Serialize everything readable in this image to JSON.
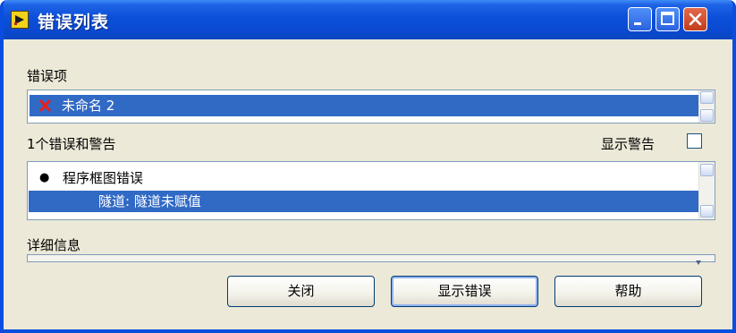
{
  "window": {
    "title": "错误列表"
  },
  "error_items": {
    "label": "错误项",
    "items": [
      {
        "icon": "red-x-icon",
        "text": "未命名 2",
        "selected": true
      }
    ]
  },
  "warnings": {
    "count_label": "1个错误和警告",
    "show_warnings_label": "显示警告",
    "show_warnings_checked": false,
    "items": [
      {
        "bullet": "●",
        "text": "程序框图错误",
        "selected": false
      },
      {
        "bullet": "",
        "text": "隧道: 隧道未赋值",
        "selected": true
      }
    ]
  },
  "details": {
    "label": "详细信息"
  },
  "buttons": {
    "close": "关闭",
    "show_error": "显示错误",
    "help": "帮助"
  },
  "colors": {
    "titlebar": "#0a4ee0",
    "selection": "#316ac5",
    "window_bg": "#ece9d8"
  }
}
